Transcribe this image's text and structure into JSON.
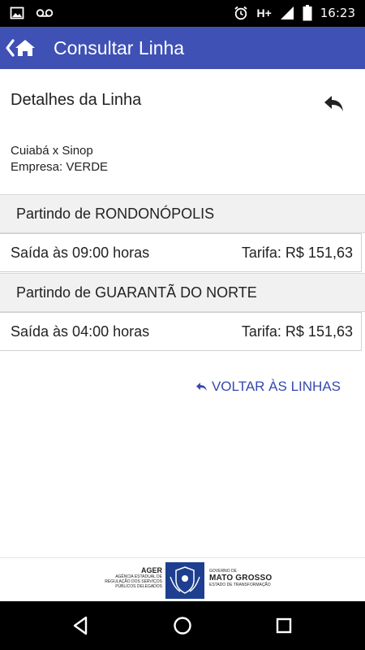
{
  "status_bar": {
    "time": "16:23",
    "network": "H+",
    "icons": [
      "image-icon",
      "voicemail-icon",
      "alarm-icon",
      "signal-icon",
      "battery-icon"
    ]
  },
  "app_bar": {
    "title": "Consultar Linha",
    "color": "#3f51b5",
    "back_icon": "back-home-icon"
  },
  "details": {
    "heading": "Detalhes da Linha",
    "route": "Cuiabá x Sinop",
    "company": "Empresa: VERDE",
    "reply_icon": "reply-arrow-icon"
  },
  "departures": [
    {
      "header": "Partindo de RONDONÓPOLIS",
      "time_text": "Saída às 09:00 horas",
      "fare_text": "Tarifa: R$ 151,63"
    },
    {
      "header": "Partindo de GUARANTÃ DO NORTE",
      "time_text": "Saída às 04:00 horas",
      "fare_text": "Tarifa: R$ 151,63"
    }
  ],
  "voltar": {
    "label": "VOLTAR ÀS LINHAS",
    "color": "#3549b0"
  },
  "footer": {
    "ager_name": "AGER",
    "ager_line1": "AGÊNCIA ESTADUAL DE",
    "ager_line2": "REGULAÇÃO DOS SERVIÇOS",
    "ager_line3": "PÚBLICOS DELEGADOS",
    "gov_line1": "GOVERNO DE",
    "gov_name": "MATO GROSSO",
    "gov_line2": "ESTADO DE TRANSFORMAÇÃO"
  },
  "nav_bar": {
    "buttons": [
      "back-triangle-icon",
      "home-circle-icon",
      "recents-square-icon"
    ]
  }
}
